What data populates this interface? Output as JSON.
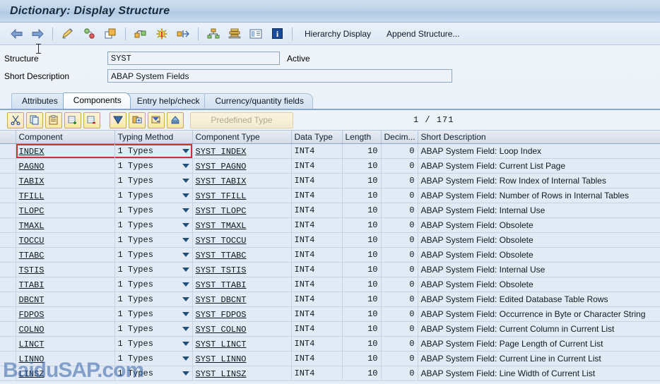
{
  "window": {
    "title": "Dictionary: Display Structure"
  },
  "toolbar": {
    "icons": [
      {
        "name": "back-icon",
        "glyph": "←"
      },
      {
        "name": "forward-icon",
        "glyph": "→"
      },
      {
        "name": "display-change-icon",
        "glyph": "✎"
      },
      {
        "name": "activate-icon",
        "glyph": "●"
      },
      {
        "name": "copy-object-icon",
        "glyph": "⧉"
      },
      {
        "name": "where-used-list-icon",
        "glyph": "⛓"
      },
      {
        "name": "expand-node-icon",
        "glyph": "✱"
      },
      {
        "name": "navigate-icon",
        "glyph": "✥"
      },
      {
        "name": "hierarchy-icon",
        "glyph": "⑂"
      },
      {
        "name": "print-icon",
        "glyph": "☰"
      },
      {
        "name": "documentation-icon",
        "glyph": "▤"
      },
      {
        "name": "information-icon",
        "glyph": "i"
      }
    ],
    "hierarchy_display_label": "Hierarchy Display",
    "append_structure_label": "Append Structure..."
  },
  "form": {
    "structure_label": "Structure",
    "structure_value": "SYST",
    "status_text": "Active",
    "short_description_label": "Short Description",
    "short_description_value": "ABAP System Fields"
  },
  "tabs": [
    {
      "label": "Attributes",
      "active": false
    },
    {
      "label": "Components",
      "active": true
    },
    {
      "label": "Entry help/check",
      "active": false
    },
    {
      "label": "Currency/quantity fields",
      "active": false
    }
  ],
  "subtoolbar": {
    "icons": [
      {
        "name": "cut-icon",
        "glyph": "✂"
      },
      {
        "name": "copy-icon",
        "glyph": "❐"
      },
      {
        "name": "paste-icon",
        "glyph": "Ὄb"
      },
      {
        "name": "insert-row-icon",
        "glyph": "＋"
      },
      {
        "name": "delete-row-icon",
        "glyph": "－"
      },
      {
        "name": "sort-descending-icon",
        "glyph": "▼"
      },
      {
        "name": "expand-include-icon",
        "glyph": "⊞"
      },
      {
        "name": "collapse-include-icon",
        "glyph": "⊟"
      },
      {
        "name": "srch-help-icon",
        "glyph": "▲"
      }
    ],
    "predefined_type_label": "Predefined Type",
    "counter": "1 / 171"
  },
  "grid": {
    "columns": [
      {
        "key": "component",
        "label": "Component"
      },
      {
        "key": "typing_method",
        "label": "Typing Method"
      },
      {
        "key": "component_type",
        "label": "Component Type"
      },
      {
        "key": "data_type",
        "label": "Data Type"
      },
      {
        "key": "length",
        "label": "Length"
      },
      {
        "key": "decimals",
        "label": "Decim..."
      },
      {
        "key": "short_description",
        "label": "Short Description"
      }
    ],
    "rows": [
      {
        "component": "INDEX",
        "typing_method": "1 Types",
        "component_type": "SYST INDEX",
        "data_type": "INT4",
        "length": "10",
        "decimals": "0",
        "short_description": "ABAP System Field: Loop Index",
        "cursor": true
      },
      {
        "component": "PAGNO",
        "typing_method": "1 Types",
        "component_type": "SYST PAGNO",
        "data_type": "INT4",
        "length": "10",
        "decimals": "0",
        "short_description": "ABAP System Field: Current List Page",
        "cursor": false
      },
      {
        "component": "TABIX",
        "typing_method": "1 Types",
        "component_type": "SYST TABIX",
        "data_type": "INT4",
        "length": "10",
        "decimals": "0",
        "short_description": "ABAP System Field: Row Index of Internal Tables",
        "cursor": false
      },
      {
        "component": "TFILL",
        "typing_method": "1 Types",
        "component_type": "SYST TFILL",
        "data_type": "INT4",
        "length": "10",
        "decimals": "0",
        "short_description": "ABAP System Field: Number of Rows in Internal Tables",
        "cursor": false
      },
      {
        "component": "TLOPC",
        "typing_method": "1 Types",
        "component_type": "SYST TLOPC",
        "data_type": "INT4",
        "length": "10",
        "decimals": "0",
        "short_description": "ABAP System Field: Internal Use",
        "cursor": false
      },
      {
        "component": "TMAXL",
        "typing_method": "1 Types",
        "component_type": "SYST TMAXL",
        "data_type": "INT4",
        "length": "10",
        "decimals": "0",
        "short_description": "ABAP System Field: Obsolete",
        "cursor": false
      },
      {
        "component": "TOCCU",
        "typing_method": "1 Types",
        "component_type": "SYST TOCCU",
        "data_type": "INT4",
        "length": "10",
        "decimals": "0",
        "short_description": "ABAP System Field: Obsolete",
        "cursor": false
      },
      {
        "component": "TTABC",
        "typing_method": "1 Types",
        "component_type": "SYST TTABC",
        "data_type": "INT4",
        "length": "10",
        "decimals": "0",
        "short_description": "ABAP System Field: Obsolete",
        "cursor": false
      },
      {
        "component": "TSTIS",
        "typing_method": "1 Types",
        "component_type": "SYST TSTIS",
        "data_type": "INT4",
        "length": "10",
        "decimals": "0",
        "short_description": "ABAP System Field: Internal Use",
        "cursor": false
      },
      {
        "component": "TTABI",
        "typing_method": "1 Types",
        "component_type": "SYST TTABI",
        "data_type": "INT4",
        "length": "10",
        "decimals": "0",
        "short_description": "ABAP System Field: Obsolete",
        "cursor": false
      },
      {
        "component": "DBCNT",
        "typing_method": "1 Types",
        "component_type": "SYST DBCNT",
        "data_type": "INT4",
        "length": "10",
        "decimals": "0",
        "short_description": "ABAP System Field: Edited Database Table Rows",
        "cursor": false
      },
      {
        "component": "FDPOS",
        "typing_method": "1 Types",
        "component_type": "SYST FDPOS",
        "data_type": "INT4",
        "length": "10",
        "decimals": "0",
        "short_description": "ABAP System Field: Occurrence in Byte or Character String",
        "cursor": false
      },
      {
        "component": "COLNO",
        "typing_method": "1 Types",
        "component_type": "SYST COLNO",
        "data_type": "INT4",
        "length": "10",
        "decimals": "0",
        "short_description": "ABAP System Field: Current Column in Current List",
        "cursor": false
      },
      {
        "component": "LINCT",
        "typing_method": "1 Types",
        "component_type": "SYST LINCT",
        "data_type": "INT4",
        "length": "10",
        "decimals": "0",
        "short_description": "ABAP System Field: Page Length of Current List",
        "cursor": false
      },
      {
        "component": "LINNO",
        "typing_method": "1 Types",
        "component_type": "SYST LINNO",
        "data_type": "INT4",
        "length": "10",
        "decimals": "0",
        "short_description": "ABAP System Field: Current Line in Current List",
        "cursor": false
      },
      {
        "component": "LINSZ",
        "typing_method": "1 Types",
        "component_type": "SYST LINSZ",
        "data_type": "INT4",
        "length": "10",
        "decimals": "0",
        "short_description": "ABAP System Field: Line Width of Current List",
        "cursor": false
      }
    ]
  },
  "watermark": {
    "text": "BaiduSAP.com"
  }
}
